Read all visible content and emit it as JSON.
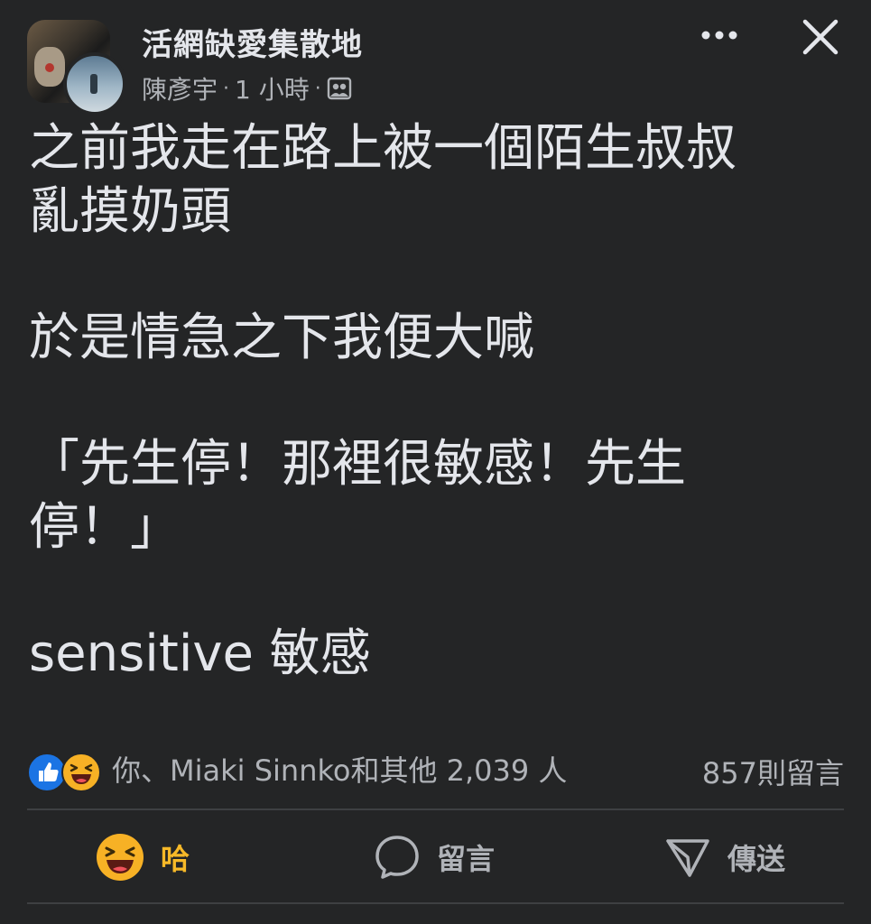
{
  "header": {
    "group_name": "活網缺愛集散地",
    "author": "陳彥宇",
    "time": "1 小時",
    "dot_sep": "·",
    "icons": [
      "more-icon",
      "close-icon",
      "audience-members-icon"
    ]
  },
  "post": {
    "line1": "之前我走在路上被一個陌生叔叔\n亂摸奶頭",
    "line2": "於是情急之下我便大喊",
    "line3": "「先生停！那裡很敏感！先生\n停！」",
    "line4": "sensitive 敏感"
  },
  "reactions": {
    "summary": "你、Miaki Sinnko和其他 2,039 人",
    "comments": "857則留言",
    "icons": [
      "like-icon",
      "haha-icon"
    ]
  },
  "actions": {
    "haha_label": "哈",
    "comment_label": "留言",
    "share_label": "傳送"
  },
  "colors": {
    "background": "#242526",
    "text": "#e4e6eb",
    "secondary": "#b0b3b8",
    "haha": "#f7b928",
    "like": "#1b74e4"
  }
}
